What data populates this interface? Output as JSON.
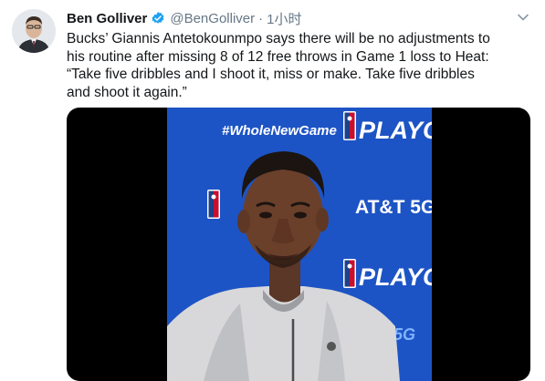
{
  "author": {
    "name": "Ben Golliver",
    "handle": "@BenGolliver",
    "separator": "·",
    "time": "1小时"
  },
  "tweet": {
    "lines": [
      "Bucks’   Giannis Antetokounmpo says there will be no adjustments to",
      "his routine after missing 8 of 12 free throws in Game 1 loss to Heat:",
      "  “Take five dribbles and I shoot it, miss or make. Take five dribbles",
      "and shoot it again.”"
    ]
  },
  "media": {
    "backdrop": {
      "hashtag": "#WholeNewGame",
      "playoffs_top": "PLAYOFFS",
      "sponsor": "AT&T 5G",
      "playoffs_mid": "PLAYOFFS",
      "bottom_5g": "5G"
    }
  },
  "colors": {
    "backdrop_blue": "#1f56c8",
    "verified_blue": "#1da1f2",
    "secondary_text": "#657786"
  }
}
